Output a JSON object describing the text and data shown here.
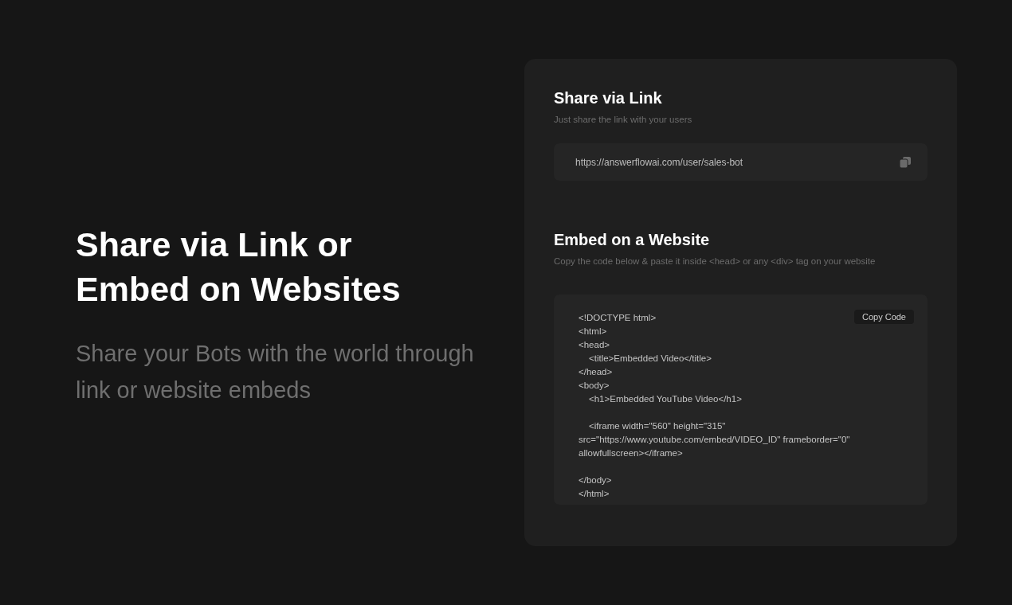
{
  "hero": {
    "title": "Share via Link or Embed on Websites",
    "subtitle": "Share your Bots with the world through link or website embeds"
  },
  "share": {
    "title": "Share via Link",
    "description": "Just share the link with your users",
    "link": "https://answerflowai.com/user/sales-bot"
  },
  "embed": {
    "title": "Embed on a Website",
    "description": "Copy the code below & paste it inside <head> or any <div> tag on your website",
    "copy_button": "Copy Code",
    "code_lines": [
      {
        "kind": "line",
        "text": "<!DOCTYPE html>"
      },
      {
        "kind": "line",
        "text": "<html>"
      },
      {
        "kind": "line",
        "text": "<head>"
      },
      {
        "kind": "indented",
        "text": "<title>Embedded Video</title>"
      },
      {
        "kind": "line",
        "text": "</head>"
      },
      {
        "kind": "line",
        "text": "<body>"
      },
      {
        "kind": "indented",
        "text": "<h1>Embedded YouTube Video</h1>"
      },
      {
        "kind": "blank"
      },
      {
        "kind": "indented",
        "text": "<iframe width=\"560\" height=\"315\" src=\"https://www.youtube.com/embed/VIDEO_ID\" frameborder=\"0\" allowfullscreen></iframe>"
      },
      {
        "kind": "blank"
      },
      {
        "kind": "line",
        "text": "</body>"
      },
      {
        "kind": "line",
        "text": "</html>"
      }
    ]
  }
}
